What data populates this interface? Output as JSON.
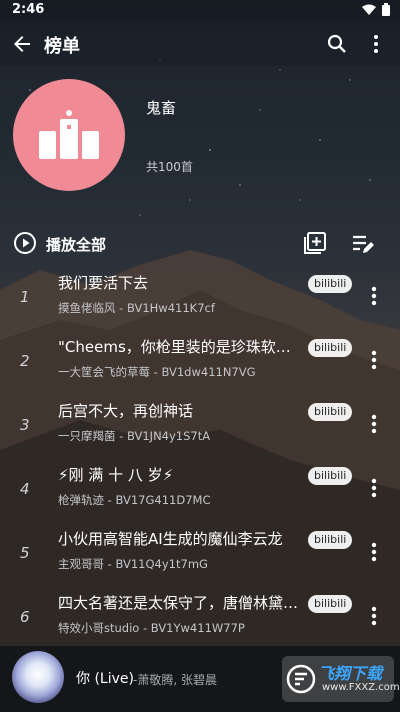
{
  "status_bar": {
    "time": "2:46"
  },
  "app_bar": {
    "title": "榜单"
  },
  "header": {
    "name": "鬼畜",
    "count": "共100首"
  },
  "actions": {
    "play_all": "播放全部"
  },
  "songs": [
    {
      "index": "1",
      "title": "我们要活下去",
      "subtitle": "摸鱼佬临风 - BV1Hw411K7cf",
      "source": "bilibili"
    },
    {
      "index": "2",
      "title": "\"Cheems，你枪里装的是珍珠软糖…",
      "subtitle": "一大筐会飞的草莓 - BV1dw411N7VG",
      "source": "bilibili"
    },
    {
      "index": "3",
      "title": "后宫不大，再创神话",
      "subtitle": "一只摩羯菌 - BV1JN4y1S7tA",
      "source": "bilibili"
    },
    {
      "index": "4",
      "title": "⚡刚 满 十 八 岁⚡",
      "subtitle": "枪弹轨迹 - BV17G411D7MC",
      "source": "bilibili"
    },
    {
      "index": "5",
      "title": "小伙用高智能AI生成的魔仙李云龙",
      "subtitle": "主观哥哥 - BV11Q4y1t7mG",
      "source": "bilibili"
    },
    {
      "index": "6",
      "title": "四大名著还是太保守了，唐僧林黛…",
      "subtitle": "特效小哥studio - BV1Yw411W77P",
      "source": "bilibili"
    }
  ],
  "player": {
    "song": "你 (Live)",
    "artist": "-萧敬腾, 张碧晨"
  },
  "watermark": {
    "brand": "飞翔下载",
    "url": "www.FXXZ.com"
  },
  "colors": {
    "cover": "#f08a95",
    "background": "#2b3139",
    "badge": "#ffffff"
  }
}
